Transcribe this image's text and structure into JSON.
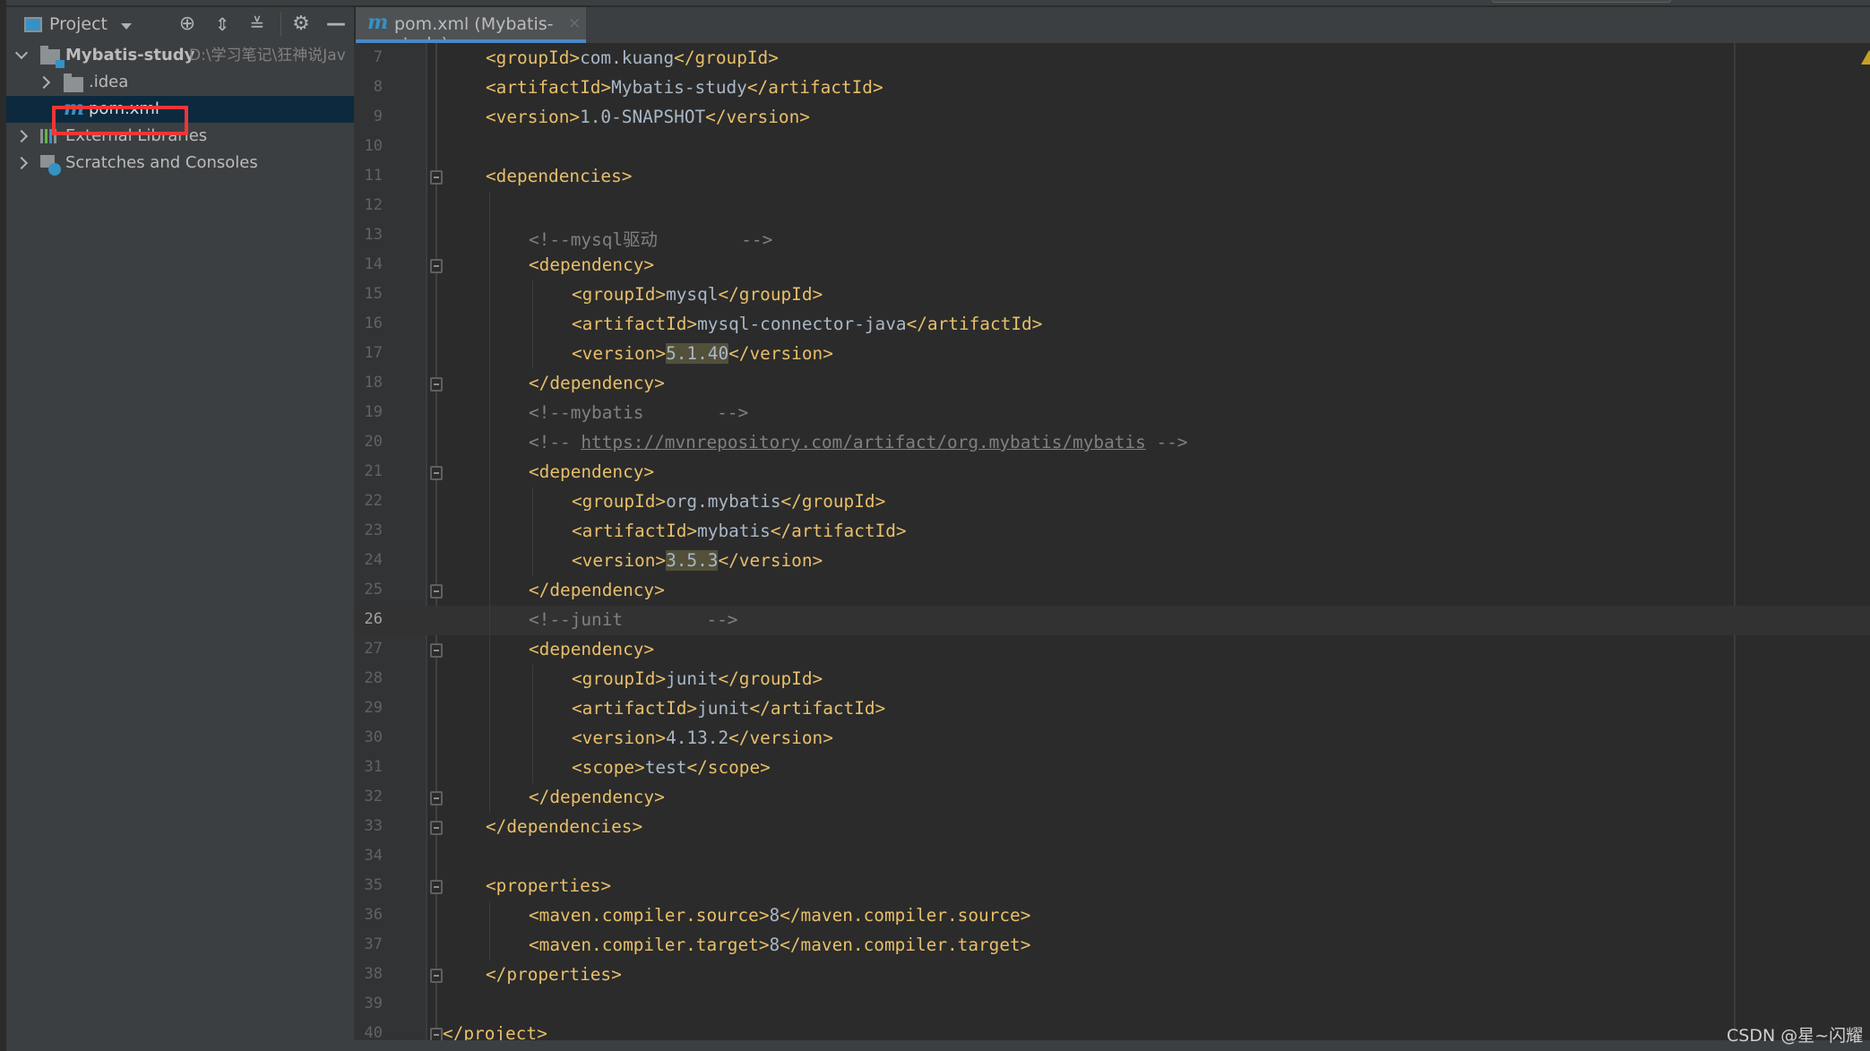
{
  "project_panel": {
    "title": "Project",
    "toolbar_icons": [
      "locate-icon",
      "expand-all-icon",
      "collapse-all-icon",
      "settings-icon",
      "hide-icon"
    ],
    "tree": [
      {
        "label": "Mybatis-study",
        "path": "D:\\学习笔记\\狂神说Jav",
        "expanded": true,
        "icon": "module-folder-icon"
      },
      {
        "label": ".idea",
        "expanded": false,
        "icon": "folder-icon"
      },
      {
        "label": "pom.xml",
        "selected": true,
        "icon": "maven-icon"
      },
      {
        "label": "External Libraries",
        "expanded": false,
        "icon": "libraries-icon"
      },
      {
        "label": "Scratches and Consoles",
        "expanded": false,
        "icon": "scratches-icon"
      }
    ]
  },
  "editor": {
    "tab": {
      "label": "pom.xml (Mybatis-study)",
      "close": "×",
      "active": true
    },
    "current_line": 26,
    "lines": [
      {
        "n": "7",
        "indent": 1,
        "parts": [
          [
            "tag",
            "<groupId>"
          ],
          [
            "txt",
            "com.kuang"
          ],
          [
            "tag",
            "</groupId>"
          ]
        ]
      },
      {
        "n": "8",
        "indent": 1,
        "parts": [
          [
            "tag",
            "<artifactId>"
          ],
          [
            "txt",
            "Mybatis-study"
          ],
          [
            "tag",
            "</artifactId>"
          ]
        ]
      },
      {
        "n": "9",
        "indent": 1,
        "parts": [
          [
            "tag",
            "<version>"
          ],
          [
            "txt",
            "1.0-SNAPSHOT"
          ],
          [
            "tag",
            "</version>"
          ]
        ]
      },
      {
        "n": "10",
        "indent": 0,
        "parts": []
      },
      {
        "n": "11",
        "indent": 1,
        "fold": true,
        "parts": [
          [
            "tag",
            "<dependencies>"
          ]
        ]
      },
      {
        "n": "12",
        "indent": 0,
        "parts": []
      },
      {
        "n": "13",
        "indent": 2,
        "parts": [
          [
            "cmt",
            "<!--mysql驱动        -->"
          ]
        ]
      },
      {
        "n": "14",
        "indent": 2,
        "fold": true,
        "parts": [
          [
            "tag",
            "<dependency>"
          ]
        ]
      },
      {
        "n": "15",
        "indent": 3,
        "parts": [
          [
            "tag",
            "<groupId>"
          ],
          [
            "txt",
            "mysql"
          ],
          [
            "tag",
            "</groupId>"
          ]
        ]
      },
      {
        "n": "16",
        "indent": 3,
        "parts": [
          [
            "tag",
            "<artifactId>"
          ],
          [
            "txt",
            "mysql-connector-java"
          ],
          [
            "tag",
            "</artifactId>"
          ]
        ]
      },
      {
        "n": "17",
        "indent": 3,
        "parts": [
          [
            "tag",
            "<version>"
          ],
          [
            "hl",
            "5.1.40"
          ],
          [
            "tag",
            "</version>"
          ]
        ]
      },
      {
        "n": "18",
        "indent": 2,
        "fold": true,
        "parts": [
          [
            "tag",
            "</dependency>"
          ]
        ]
      },
      {
        "n": "19",
        "indent": 2,
        "parts": [
          [
            "cmt",
            "<!--mybatis       -->"
          ]
        ]
      },
      {
        "n": "20",
        "indent": 2,
        "parts": [
          [
            "cmt",
            "<!-- "
          ],
          [
            "url",
            "https://mvnrepository.com/artifact/org.mybatis/mybatis"
          ],
          [
            "cmt",
            " -->"
          ]
        ]
      },
      {
        "n": "21",
        "indent": 2,
        "fold": true,
        "parts": [
          [
            "tag",
            "<dependency>"
          ]
        ]
      },
      {
        "n": "22",
        "indent": 3,
        "parts": [
          [
            "tag",
            "<groupId>"
          ],
          [
            "txt",
            "org.mybatis"
          ],
          [
            "tag",
            "</groupId>"
          ]
        ]
      },
      {
        "n": "23",
        "indent": 3,
        "parts": [
          [
            "tag",
            "<artifactId>"
          ],
          [
            "txt",
            "mybatis"
          ],
          [
            "tag",
            "</artifactId>"
          ]
        ]
      },
      {
        "n": "24",
        "indent": 3,
        "parts": [
          [
            "tag",
            "<version>"
          ],
          [
            "hl",
            "3.5.3"
          ],
          [
            "tag",
            "</version>"
          ]
        ]
      },
      {
        "n": "25",
        "indent": 2,
        "fold": true,
        "parts": [
          [
            "tag",
            "</dependency>"
          ]
        ]
      },
      {
        "n": "26",
        "indent": 2,
        "parts": [
          [
            "cmt",
            "<!--junit        -->"
          ]
        ]
      },
      {
        "n": "27",
        "indent": 2,
        "fold": true,
        "parts": [
          [
            "tag",
            "<dependency>"
          ]
        ]
      },
      {
        "n": "28",
        "indent": 3,
        "parts": [
          [
            "tag",
            "<groupId>"
          ],
          [
            "txt",
            "junit"
          ],
          [
            "tag",
            "</groupId>"
          ]
        ]
      },
      {
        "n": "29",
        "indent": 3,
        "parts": [
          [
            "tag",
            "<artifactId>"
          ],
          [
            "txt",
            "junit"
          ],
          [
            "tag",
            "</artifactId>"
          ]
        ]
      },
      {
        "n": "30",
        "indent": 3,
        "parts": [
          [
            "tag",
            "<version>"
          ],
          [
            "txt",
            "4.13.2"
          ],
          [
            "tag",
            "</version>"
          ]
        ]
      },
      {
        "n": "31",
        "indent": 3,
        "parts": [
          [
            "tag",
            "<scope>"
          ],
          [
            "txt",
            "test"
          ],
          [
            "tag",
            "</scope>"
          ]
        ]
      },
      {
        "n": "32",
        "indent": 2,
        "fold": true,
        "parts": [
          [
            "tag",
            "</dependency>"
          ]
        ]
      },
      {
        "n": "33",
        "indent": 1,
        "fold": true,
        "parts": [
          [
            "tag",
            "</dependencies>"
          ]
        ]
      },
      {
        "n": "34",
        "indent": 0,
        "parts": []
      },
      {
        "n": "35",
        "indent": 1,
        "fold": true,
        "parts": [
          [
            "tag",
            "<properties>"
          ]
        ]
      },
      {
        "n": "36",
        "indent": 2,
        "parts": [
          [
            "tag",
            "<maven.compiler.source>"
          ],
          [
            "txt",
            "8"
          ],
          [
            "tag",
            "</maven.compiler.source>"
          ]
        ]
      },
      {
        "n": "37",
        "indent": 2,
        "parts": [
          [
            "tag",
            "<maven.compiler.target>"
          ],
          [
            "txt",
            "8"
          ],
          [
            "tag",
            "</maven.compiler.target>"
          ]
        ]
      },
      {
        "n": "38",
        "indent": 1,
        "fold": true,
        "parts": [
          [
            "tag",
            "</properties>"
          ]
        ]
      },
      {
        "n": "39",
        "indent": 0,
        "parts": []
      },
      {
        "n": "40",
        "indent": 0,
        "fold": true,
        "parts": [
          [
            "tag",
            "</project>"
          ]
        ]
      }
    ]
  },
  "colors": {
    "tag": "#e8bf6a",
    "text": "#a9b7c6",
    "comment": "#808080",
    "selection": "#0d293e",
    "accent": "#4a88c7",
    "highlight_box": "#f03636"
  },
  "watermark": "CSDN @星~闪耀"
}
